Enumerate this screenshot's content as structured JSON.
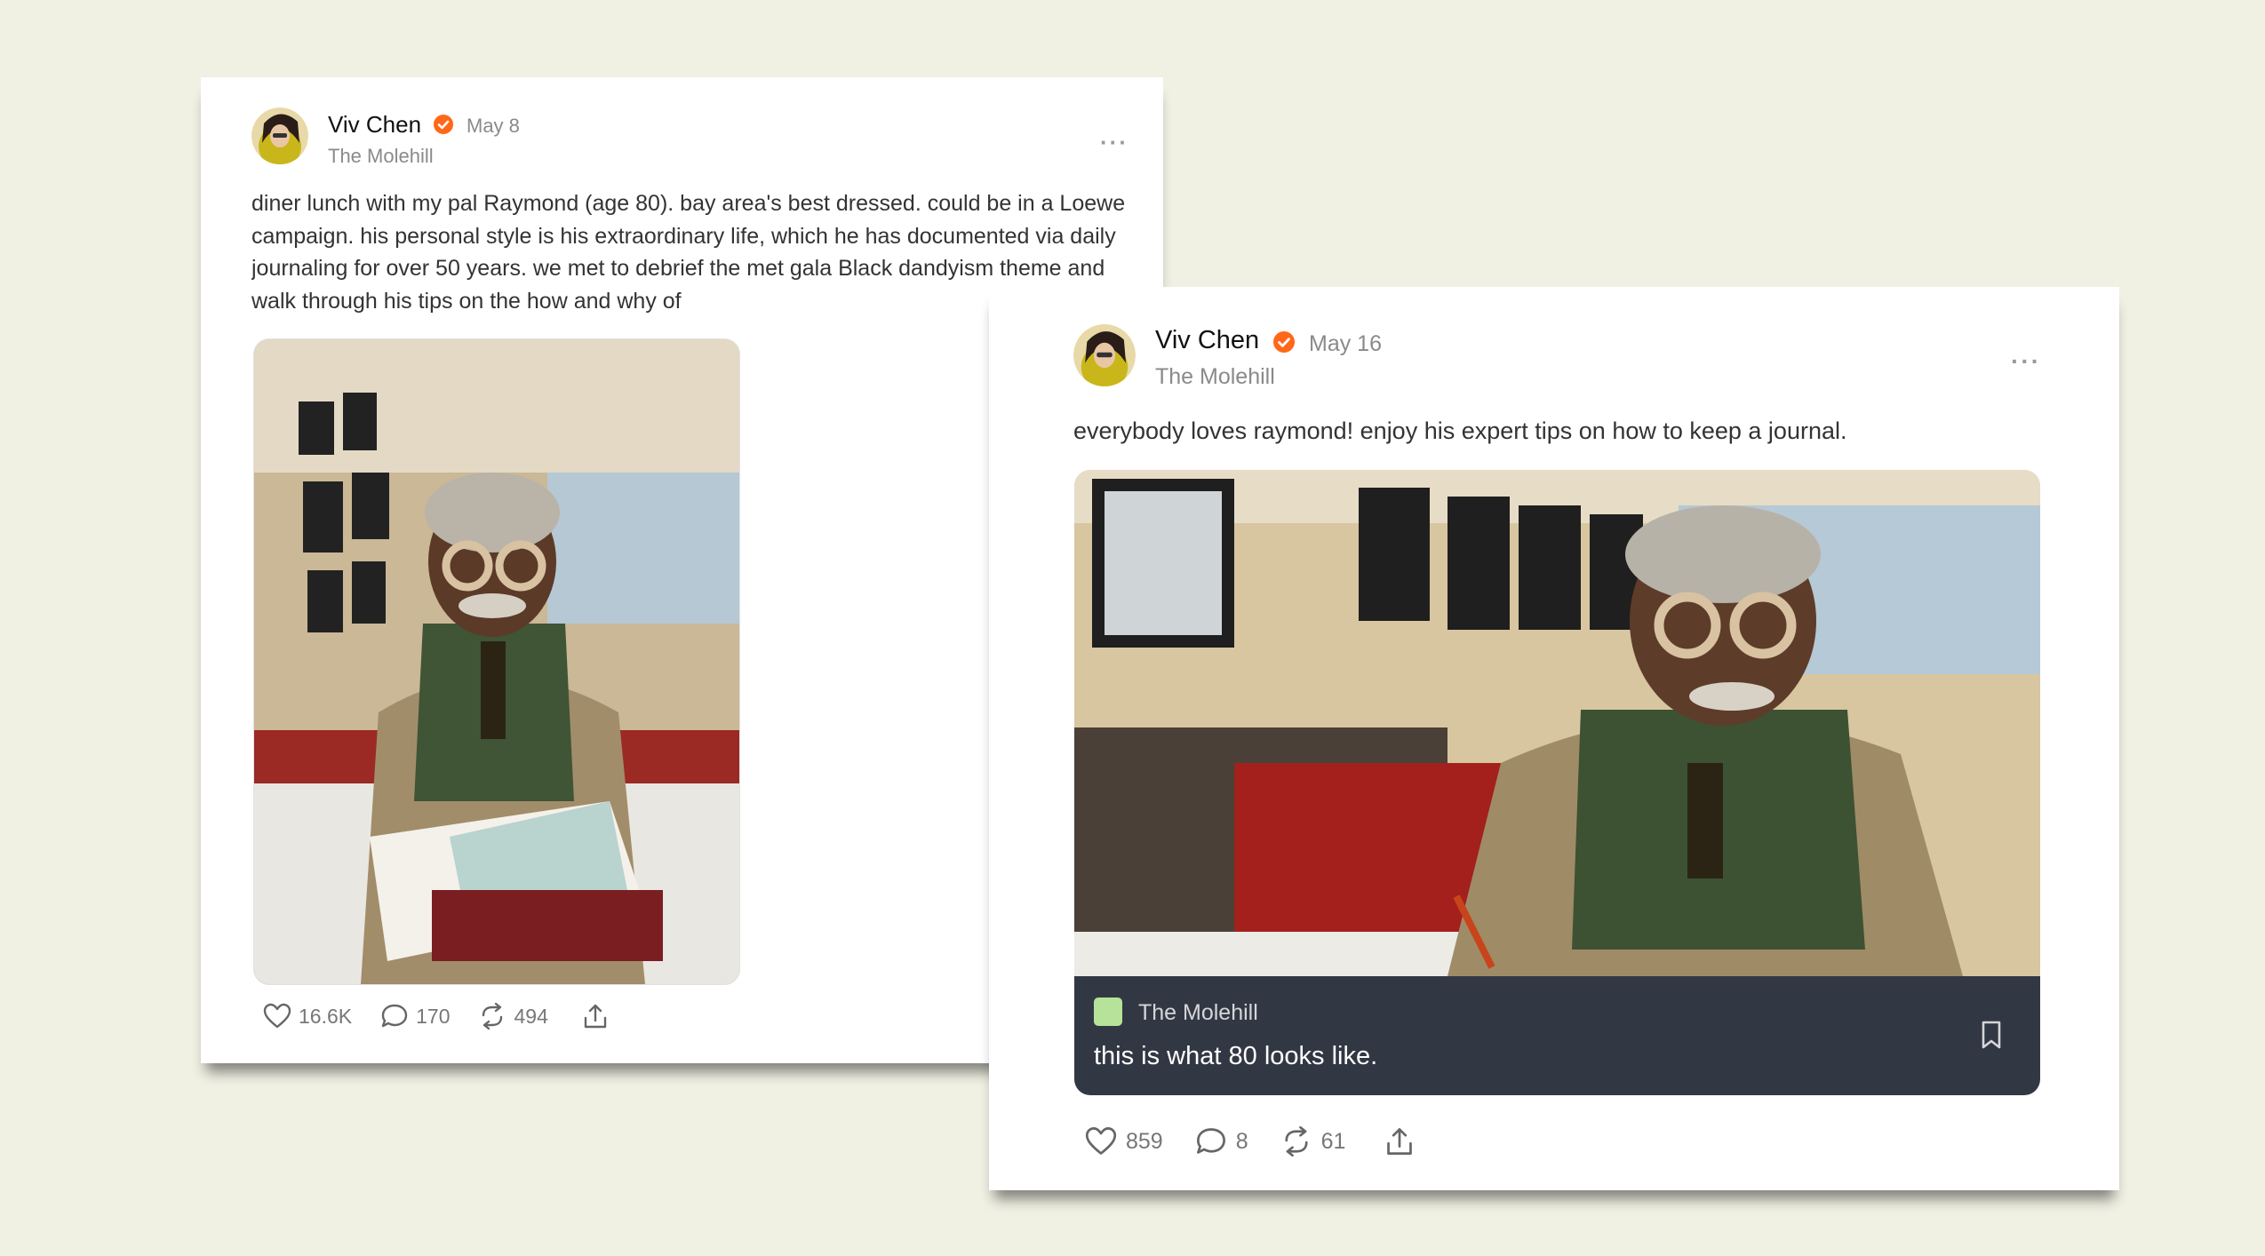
{
  "post1": {
    "author": "Viv Chen",
    "date": "May 8",
    "publication": "The Molehill",
    "more": "···",
    "text": "diner lunch with my pal Raymond (age 80). bay area's best dressed. could be in a Loewe campaign. his personal style is his extraordinary life, which he has documented via daily journaling for over 50 years. we met to debrief the met gala Black dandyism theme and walk through his tips on the how and why of",
    "likes": "16.6K",
    "comments": "170",
    "restacks": "494"
  },
  "post2": {
    "author": "Viv Chen",
    "date": "May 16",
    "publication": "The Molehill",
    "more": "···",
    "text": "everybody loves raymond! enjoy his expert tips on how to keep a journal.",
    "embed_publication": "The Molehill",
    "embed_title": "this is what 80 looks like.",
    "likes": "859",
    "comments": "8",
    "restacks": "61"
  },
  "colors": {
    "background": "#f0f0e3",
    "verified": "#ff6719",
    "caption_bar": "#323843"
  },
  "icons": [
    "heart-icon",
    "comment-icon",
    "restack-icon",
    "share-icon",
    "bookmark-icon",
    "verified-icon",
    "more-icon"
  ]
}
